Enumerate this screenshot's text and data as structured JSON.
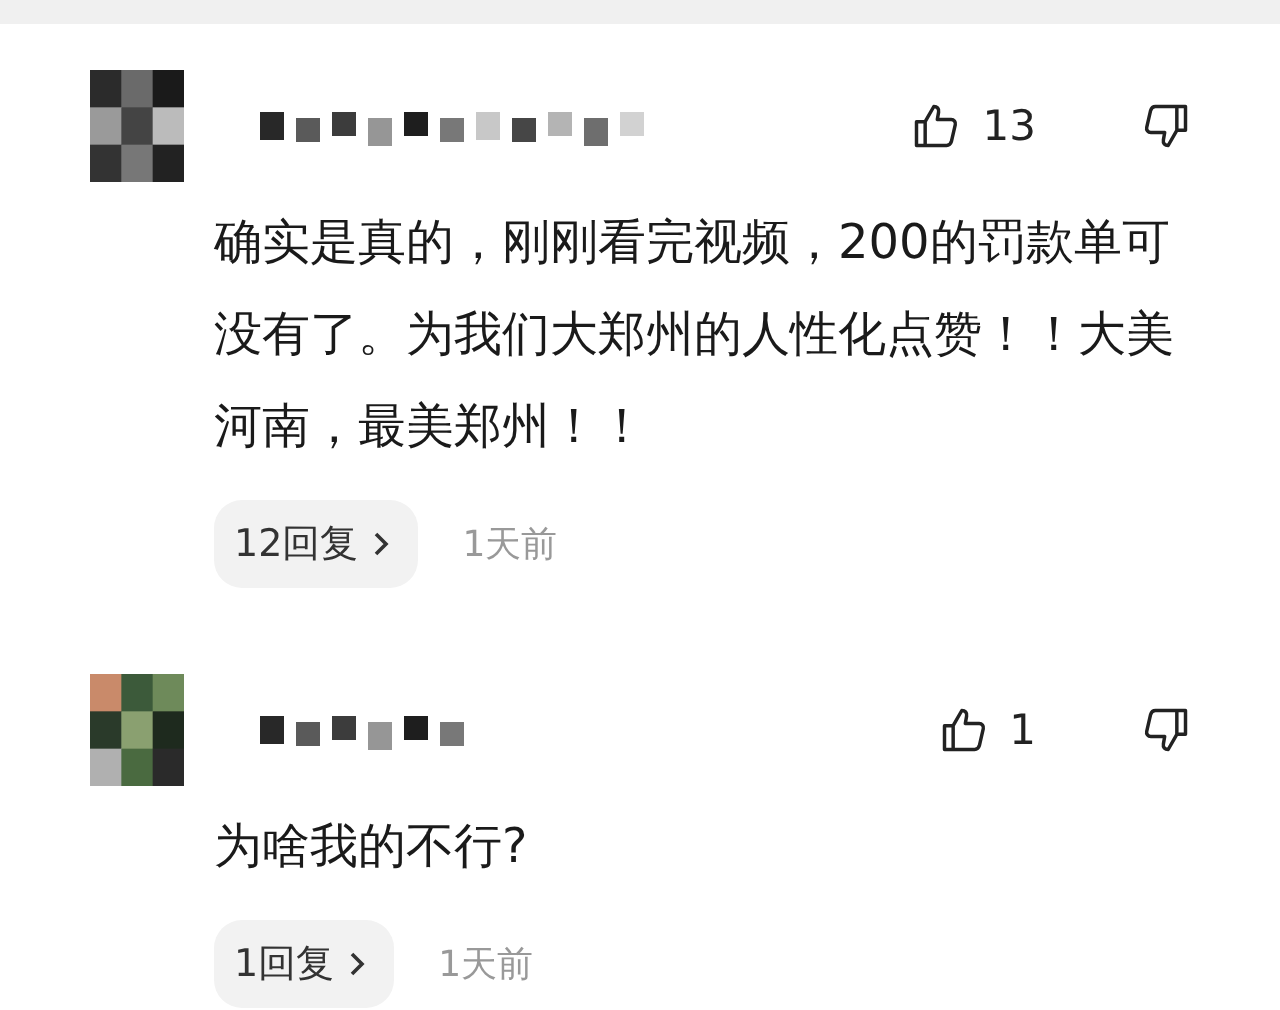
{
  "comments": [
    {
      "likes": "13",
      "text": "确实是真的，刚刚看完视频，200的罚款单可没有了。为我们大郑州的人性化点赞！！大美河南，最美郑州！！",
      "replies": "12回复",
      "time": "1天前"
    },
    {
      "likes": "1",
      "text": "为啥我的不行?",
      "replies": "1回复",
      "time": "1天前"
    }
  ]
}
